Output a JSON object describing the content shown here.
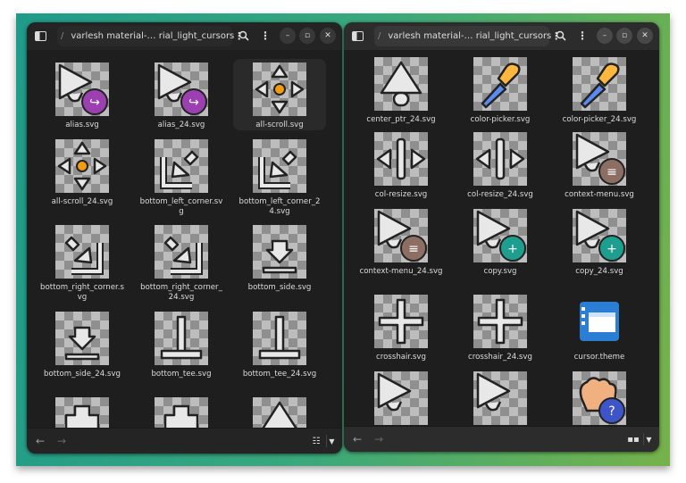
{
  "windows": [
    {
      "path_separator": "/",
      "title": "varlesh material-… rial_light_cursors",
      "items": [
        {
          "label": "alias.svg",
          "icon": "alias-icon"
        },
        {
          "label": "alias_24.svg",
          "icon": "alias-icon"
        },
        {
          "label": "all-scroll.svg",
          "icon": "all-scroll-icon",
          "selected": true
        },
        {
          "label": "all-scroll_24.svg",
          "icon": "all-scroll-icon"
        },
        {
          "label": "bottom_left_corner.svg",
          "icon": "bottom-left-corner-icon"
        },
        {
          "label": "bottom_left_corner_24.svg",
          "icon": "bottom-left-corner-icon"
        },
        {
          "label": "bottom_right_corner.svg",
          "icon": "bottom-right-corner-icon"
        },
        {
          "label": "bottom_right_corner_24.svg",
          "icon": "bottom-right-corner-icon"
        },
        {
          "label": "bottom_side.svg",
          "icon": "bottom-side-icon"
        },
        {
          "label": "bottom_side_24.svg",
          "icon": "bottom-side-icon"
        },
        {
          "label": "bottom_tee.svg",
          "icon": "bottom-tee-icon"
        },
        {
          "label": "bottom_tee_24.svg",
          "icon": "bottom-tee-icon"
        },
        {
          "label": "",
          "icon": "cross-blob-icon"
        },
        {
          "label": "",
          "icon": "cross-blob-icon"
        },
        {
          "label": "",
          "icon": "center-ptr-icon"
        }
      ]
    },
    {
      "path_separator": "/",
      "title": "varlesh material-… rial_light_cursors",
      "items": [
        {
          "label": "center_ptr_24.svg",
          "icon": "center-ptr-icon"
        },
        {
          "label": "color-picker.svg",
          "icon": "color-picker-icon"
        },
        {
          "label": "color-picker_24.svg",
          "icon": "color-picker-icon"
        },
        {
          "label": "col-resize.svg",
          "icon": "col-resize-icon"
        },
        {
          "label": "col-resize_24.svg",
          "icon": "col-resize-icon"
        },
        {
          "label": "context-menu.svg",
          "icon": "context-menu-icon"
        },
        {
          "label": "context-menu_24.svg",
          "icon": "context-menu-icon"
        },
        {
          "label": "copy.svg",
          "icon": "copy-icon"
        },
        {
          "label": "copy_24.svg",
          "icon": "copy-icon"
        },
        {
          "label": "crosshair.svg",
          "icon": "crosshair-icon"
        },
        {
          "label": "crosshair_24.svg",
          "icon": "crosshair-icon"
        },
        {
          "label": "cursor.theme",
          "icon": "theme-file-icon"
        },
        {
          "label": "",
          "icon": "pointer-icon"
        },
        {
          "label": "",
          "icon": "pointer-icon"
        },
        {
          "label": "",
          "icon": "help-hand-icon"
        }
      ]
    }
  ],
  "header": {
    "menu_dots": "⋮"
  },
  "colors": {
    "alias": "#9c3fb0",
    "context": "#8d6e63",
    "copy": "#1e9e8e",
    "scroll": "#f39c12",
    "picker": "#ffb83d",
    "theme": "#2a7fd4",
    "help": "#3d55c8"
  }
}
